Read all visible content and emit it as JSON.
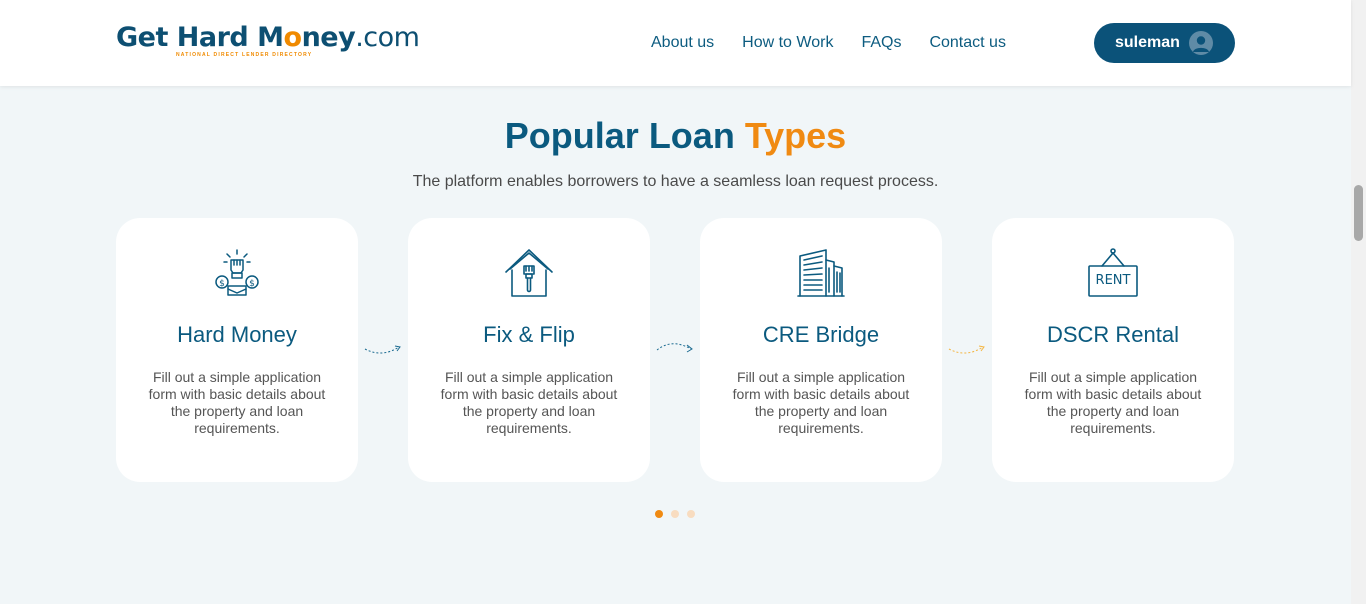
{
  "header": {
    "logo": {
      "part1": "Get Hard M",
      "part2": "ney",
      "part3": ".com",
      "tagline": "NATIONAL DIRECT LENDER DIRECTORY"
    },
    "nav": [
      {
        "label": "About us"
      },
      {
        "label": "How to Work"
      },
      {
        "label": "FAQs"
      },
      {
        "label": "Contact us"
      }
    ],
    "user": {
      "name": "suleman"
    }
  },
  "section": {
    "title_main": "Popular Loan ",
    "title_accent": "Types",
    "subtitle": "The platform enables borrowers to have a seamless loan request process."
  },
  "cards": [
    {
      "title": "Hard Money",
      "description": "Fill out a simple application form with basic details about the property and loan requirements.",
      "icon": "money-hands-icon"
    },
    {
      "title": "Fix & Flip",
      "description": "Fill out a simple application form with basic details about the property and loan requirements.",
      "icon": "house-brush-icon"
    },
    {
      "title": "CRE Bridge",
      "description": "Fill out a simple application form with basic details about the property and loan requirements.",
      "icon": "building-icon"
    },
    {
      "title": "DSCR Rental",
      "description": "Fill out a simple application form with basic details about the property and loan requirements.",
      "icon": "rent-sign-icon",
      "icon_text": "RENT"
    }
  ],
  "carousel": {
    "page_count": 3,
    "active_index": 0
  },
  "colors": {
    "primary": "#0b5a7f",
    "accent": "#f08a12",
    "background": "#f1f6f8"
  }
}
